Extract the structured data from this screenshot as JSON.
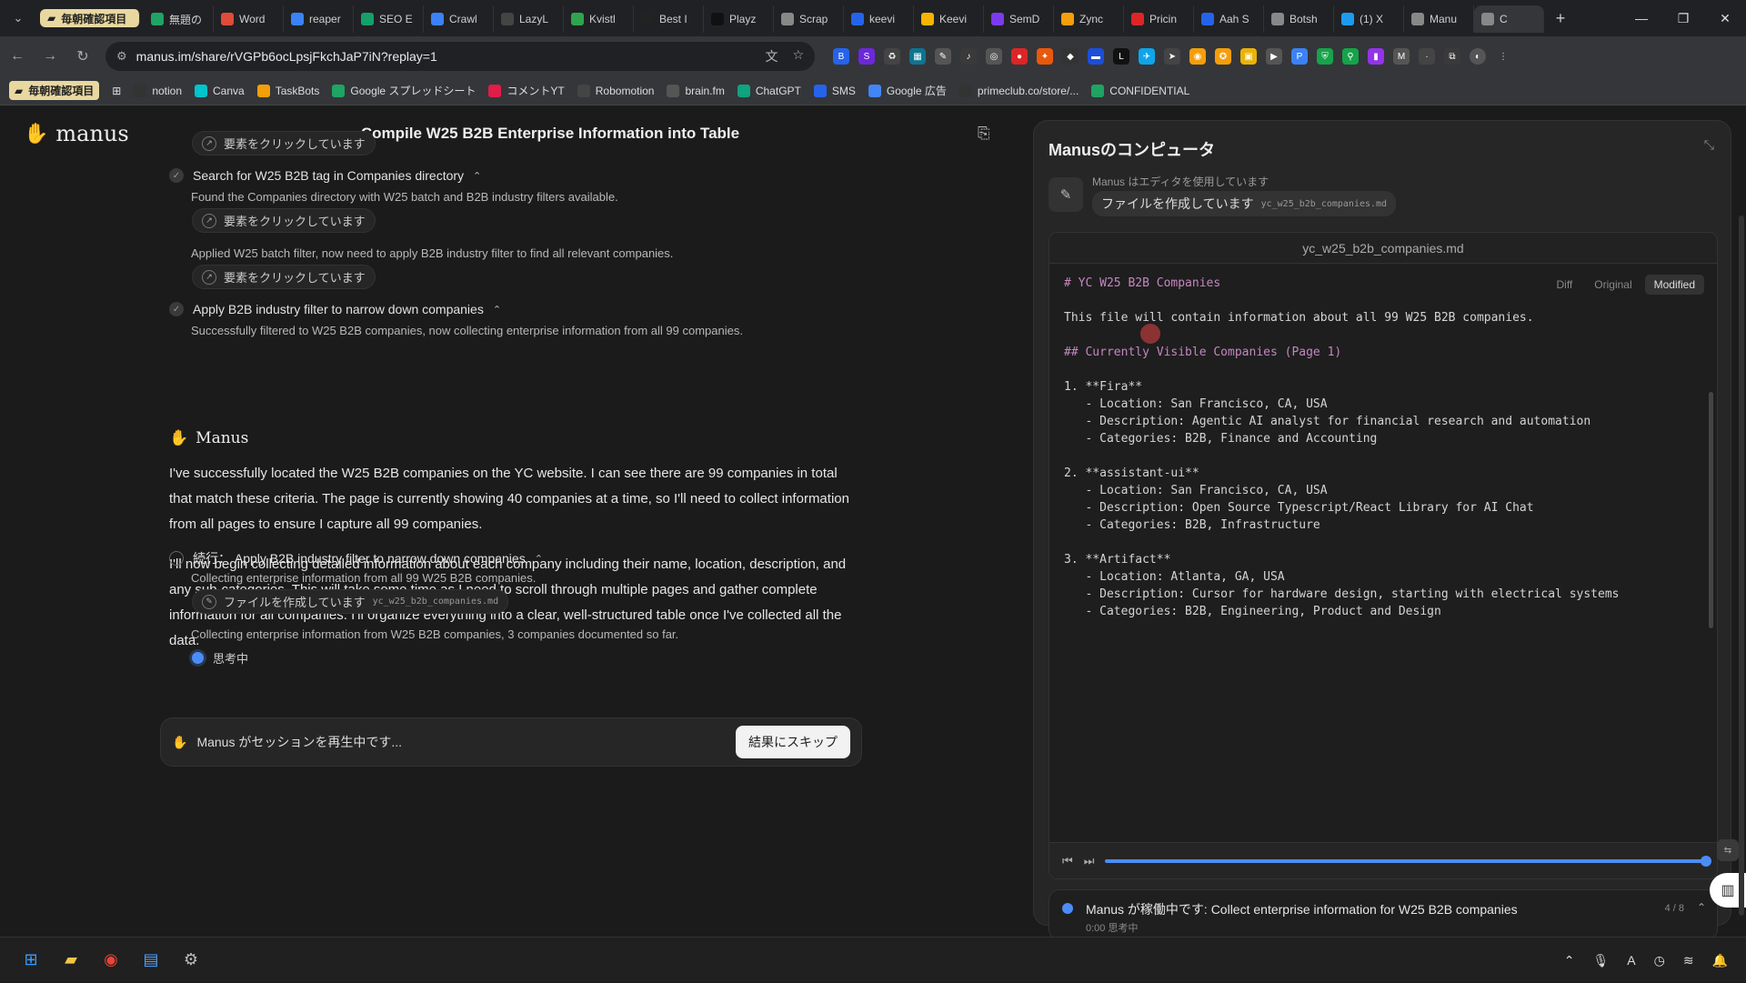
{
  "browser": {
    "pinned_tab": "毎朝確認項目",
    "tabs": [
      {
        "label": "無題の",
        "color": "#1fa463"
      },
      {
        "label": "Word",
        "color": "#e04b3a"
      },
      {
        "label": "reaper",
        "color": "#3b82f6"
      },
      {
        "label": "SEO E",
        "color": "#15a06a"
      },
      {
        "label": "Crawl",
        "color": "#3b82f6"
      },
      {
        "label": "LazyL",
        "color": "#444"
      },
      {
        "label": "Kvistl",
        "color": "#2ea44f"
      },
      {
        "label": "Best I",
        "color": "#222"
      },
      {
        "label": "Playz",
        "color": "#111"
      },
      {
        "label": "Scrap",
        "color": "#888"
      },
      {
        "label": "keevi",
        "color": "#2563eb"
      },
      {
        "label": "Keevi",
        "color": "#f4b400"
      },
      {
        "label": "SemD",
        "color": "#7c3aed"
      },
      {
        "label": "Zync",
        "color": "#f59e0b"
      },
      {
        "label": "Pricin",
        "color": "#dc2626"
      },
      {
        "label": "Aah S",
        "color": "#2563eb"
      },
      {
        "label": "Botsh",
        "color": "#888"
      },
      {
        "label": "(1) X",
        "color": "#1d9bf0"
      },
      {
        "label": "Manu",
        "color": "#888"
      },
      {
        "label": "C",
        "color": "#888"
      }
    ],
    "url": "manus.im/share/rVGPb6ocLpsjFkchJaP7iN?replay=1",
    "bookmarks_folder": "毎朝確認項目",
    "bookmarks": [
      {
        "label": "notion",
        "color": "#333"
      },
      {
        "label": "Canva",
        "color": "#00c4cc"
      },
      {
        "label": "TaskBots",
        "color": "#f59e0b"
      },
      {
        "label": "Google スプレッドシート",
        "color": "#1fa463"
      },
      {
        "label": "コメントYT",
        "color": "#e11d48"
      },
      {
        "label": "Robomotion",
        "color": "#444"
      },
      {
        "label": "brain.fm",
        "color": "#555"
      },
      {
        "label": "ChatGPT",
        "color": "#10a37f"
      },
      {
        "label": "SMS",
        "color": "#2563eb"
      },
      {
        "label": "Google 広告",
        "color": "#4285f4"
      },
      {
        "label": "primeclub.co/store/...",
        "color": "#333"
      },
      {
        "label": "CONFIDENTIAL",
        "color": "#1fa463"
      }
    ]
  },
  "app": {
    "logo_text": "manus",
    "title": "Compile W25 B2B Enterprise Information into Table"
  },
  "chat": {
    "pill_click_1": "要素をクリックしています",
    "step_1": "Search for W25 B2B tag in Companies directory",
    "step_1_sub": "Found the Companies directory with W25 batch and B2B industry filters available.",
    "pill_click_2": "要素をクリックしています",
    "step_1_sub2": "Applied W25 batch filter, now need to apply B2B industry filter to find all relevant companies.",
    "pill_click_3": "要素をクリックしています",
    "step_2": "Apply B2B industry filter to narrow down companies",
    "step_2_sub": "Successfully filtered to W25 B2B companies, now collecting enterprise information from all 99 companies.",
    "manus_label": "Manus",
    "para_1": "I've successfully located the W25 B2B companies on the YC website. I can see there are 99 companies in total that match these criteria. The page is currently showing 40 companies at a time, so I'll need to collect information from all pages to ensure I capture all 99 companies.",
    "para_2": "I'll now begin collecting detailed information about each company including their name, location, description, and any sub-categories. This will take some time as I need to scroll through multiple pages and gather complete information for all companies. I'll organize everything into a clear, well-structured table once I've collected all the data.",
    "step_3": "続行： Apply B2B industry filter to narrow down companies",
    "step_3_sub": "Collecting enterprise information from all 99 W25 B2B companies.",
    "pill_file": "ファイルを作成しています",
    "pill_file_name": "yc_w25_b2b_companies.md",
    "step_3_sub2": "Collecting enterprise information from W25 B2B companies, 3 companies documented so far.",
    "thinking": "思考中",
    "replay_text": "Manus がセッションを再生中です...",
    "skip_button": "結果にスキップ"
  },
  "computer": {
    "title": "Manusのコンピュータ",
    "tool_using": "Manus はエディタを使用しています",
    "tool_action": "ファイルを作成しています",
    "tool_file": "yc_w25_b2b_companies.md",
    "editor_filename": "yc_w25_b2b_companies.md",
    "view_diff": "Diff",
    "view_original": "Original",
    "view_modified": "Modified",
    "code_lines": [
      {
        "text": "# YC W25 B2B Companies",
        "kind": "h"
      },
      {
        "text": "",
        "kind": ""
      },
      {
        "text": "This file will contain information about all 99 W25 B2B companies.",
        "kind": ""
      },
      {
        "text": "",
        "kind": ""
      },
      {
        "text": "## Currently Visible Companies (Page 1)",
        "kind": "h"
      },
      {
        "text": "",
        "kind": ""
      },
      {
        "text": "1. **Fira**",
        "kind": ""
      },
      {
        "text": "   - Location: San Francisco, CA, USA",
        "kind": ""
      },
      {
        "text": "   - Description: Agentic AI analyst for financial research and automation",
        "kind": ""
      },
      {
        "text": "   - Categories: B2B, Finance and Accounting",
        "kind": ""
      },
      {
        "text": "",
        "kind": ""
      },
      {
        "text": "2. **assistant-ui**",
        "kind": ""
      },
      {
        "text": "   - Location: San Francisco, CA, USA",
        "kind": ""
      },
      {
        "text": "   - Description: Open Source Typescript/React Library for AI Chat",
        "kind": ""
      },
      {
        "text": "   - Categories: B2B, Infrastructure",
        "kind": ""
      },
      {
        "text": "",
        "kind": ""
      },
      {
        "text": "3. **Artifact**",
        "kind": ""
      },
      {
        "text": "   - Location: Atlanta, GA, USA",
        "kind": ""
      },
      {
        "text": "   - Description: Cursor for hardware design, starting with electrical systems",
        "kind": ""
      },
      {
        "text": "   - Categories: B2B, Engineering, Product and Design",
        "kind": ""
      }
    ],
    "playback_progress": 1.0,
    "status_text": "Manus が稼働中です: Collect enterprise information for W25 B2B companies",
    "status_time": "0:00",
    "status_sub": "思考中",
    "status_count": "4 / 8"
  }
}
